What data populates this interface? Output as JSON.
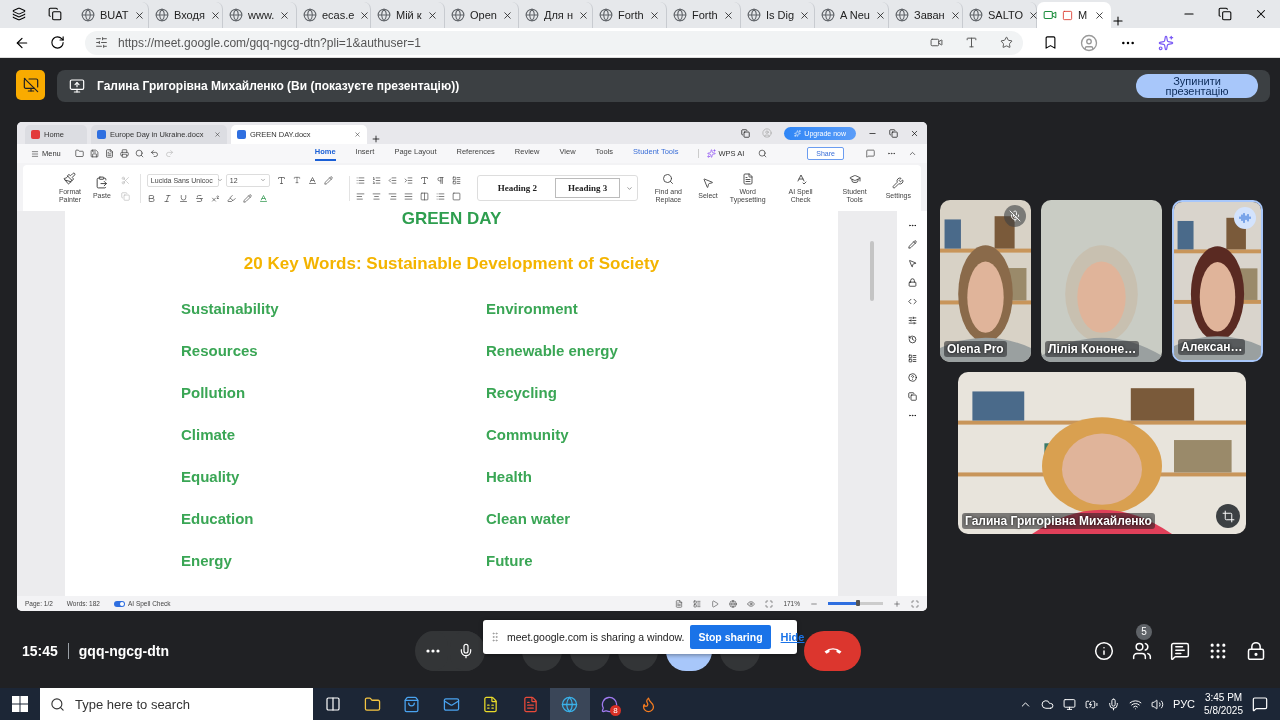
{
  "browser": {
    "tabs": [
      {
        "title": "BUAT",
        "selected": false
      },
      {
        "title": "Входя",
        "selected": false
      },
      {
        "title": "www.",
        "selected": false
      },
      {
        "title": "ecas.e",
        "selected": false
      },
      {
        "title": "Мій к",
        "selected": false
      },
      {
        "title": "Open",
        "selected": false
      },
      {
        "title": "Для н",
        "selected": false
      },
      {
        "title": "Forth",
        "selected": false
      },
      {
        "title": "Forth",
        "selected": false
      },
      {
        "title": "Is Dig",
        "selected": false
      },
      {
        "title": "A Neu",
        "selected": false
      },
      {
        "title": "Заван",
        "selected": false
      },
      {
        "title": "SALTO",
        "selected": false
      },
      {
        "title": "M",
        "selected": true
      }
    ],
    "address": "https://meet.google.com/gqq-ngcg-dtn?pli=1&authuser=1"
  },
  "meet": {
    "banner": {
      "presenter": "Галина Григорівна Михайленко (Ви (показуєте презентацію))",
      "stop_button": "Зупинити презентацію"
    },
    "wps": {
      "tabs": [
        {
          "title": "Home",
          "kind": "home",
          "selected": false
        },
        {
          "title": "Europe Day in Ukraine.docx",
          "kind": "doc",
          "selected": false
        },
        {
          "title": "GREEN DAY.docx",
          "kind": "doc",
          "selected": true
        }
      ],
      "upgrade_button": "Upgrade now",
      "menu_button": "Menu",
      "ribbon_tabs": [
        {
          "label": "Home",
          "kind": "plain",
          "selected": true
        },
        {
          "label": "Insert",
          "kind": "plain",
          "selected": false
        },
        {
          "label": "Page Layout",
          "kind": "plain",
          "selected": false
        },
        {
          "label": "References",
          "kind": "plain",
          "selected": false
        },
        {
          "label": "Review",
          "kind": "plain",
          "selected": false
        },
        {
          "label": "View",
          "kind": "plain",
          "selected": false
        },
        {
          "label": "Tools",
          "kind": "plain",
          "selected": false
        },
        {
          "label": "Student Tools",
          "kind": "accent",
          "selected": false
        }
      ],
      "ai_button": "WPS AI",
      "share_button": "Share",
      "ribbon": {
        "format_painter": "Format Painter",
        "paste": "Paste",
        "font": "Lucida Sans Unicoc",
        "size": "12",
        "styles": [
          "Heading 2",
          "Heading 3"
        ],
        "tools": [
          "Find and Replace",
          "Select",
          "Word Typesetting",
          "AI Spell Check",
          "Student Tools",
          "Settings"
        ]
      },
      "document": {
        "title": "GREEN DAY",
        "subtitle": "20 Key Words: Sustainable Development of Society",
        "rows": [
          {
            "left": "Sustainability",
            "right": "Environment"
          },
          {
            "left": "Resources",
            "right": "Renewable energy"
          },
          {
            "left": "Pollution",
            "right": "Recycling"
          },
          {
            "left": "Climate",
            "right": "Community"
          },
          {
            "left": "Equality",
            "right": "Health"
          },
          {
            "left": "Education",
            "right": "Clean water"
          },
          {
            "left": "Energy",
            "right": "Future"
          }
        ]
      },
      "status": {
        "page": "Page: 1/2",
        "words": "Words: 182",
        "spell_check": {
          "label": "AI Spell Check",
          "on": true
        },
        "zoom": {
          "reading": "171%",
          "level": 0.55
        }
      }
    },
    "participants": [
      {
        "name": "Olena Pro",
        "muted": true,
        "speaking": false
      },
      {
        "name": "Лілія Кононе…",
        "muted": false,
        "speaking": false
      },
      {
        "name": "Алексан…",
        "muted": false,
        "speaking": true
      }
    ],
    "main_tile": {
      "name": "Галина Григорівна Михайленко"
    },
    "time": "15:45",
    "code": "gqq-ngcg-dtn",
    "share_notice": {
      "text": "meet.google.com is sharing a window.",
      "stop": "Stop sharing",
      "hide": "Hide"
    },
    "people_count": "5"
  },
  "taskbar": {
    "search_placeholder": "Type here to search",
    "app_badge": "8",
    "language": "РУС",
    "time": "3:45 PM",
    "date": "5/8/2025"
  }
}
